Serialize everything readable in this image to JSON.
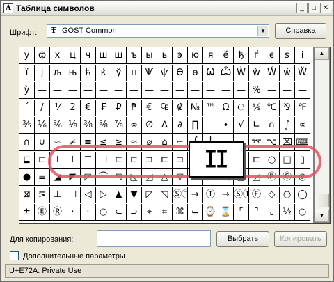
{
  "window": {
    "title": "Таблица символов",
    "app_icon": "charmap-icon",
    "minimize_glyph": "_",
    "maximize_glyph": "□",
    "close_glyph": "✕"
  },
  "font": {
    "label": "Шрифт:",
    "value": "GOST Common",
    "type_glyph": "Ŧ",
    "help_button": "Справка"
  },
  "grid": {
    "rows": [
      [
        "у",
        "ф",
        "х",
        "ц",
        "ч",
        "ш",
        "щ",
        "ъ",
        "ы",
        "ь",
        "э",
        "ю",
        "я",
        "ё",
        "ђ",
        "ѓ",
        "є",
        "ѕ",
        "і"
      ],
      [
        "ї",
        "ј",
        "љ",
        "њ",
        "ћ",
        "ќ",
        "ў",
        "џ",
        "Ѱ",
        "ѱ",
        "Ѳ",
        "ѳ",
        "Ѡ",
        "Ѽ",
        "Ẁ",
        "ẁ",
        "Ẃ",
        "ẃ",
        "Ẅ"
      ],
      [
        "ỳ",
        "—",
        "—",
        "—",
        "—",
        "—",
        "—",
        "—",
        "—",
        "—",
        "—",
        "—",
        "—",
        "—",
        "—",
        "%",
        "—",
        "—",
        "—"
      ],
      [
        "´",
        "/",
        "⅟",
        "2",
        "€",
        "₣",
        "₽",
        "₱",
        "€",
        "₠",
        "₡",
        "№",
        "™",
        "Ω",
        "℮",
        "⅍",
        "℃",
        "⅋",
        "℉"
      ],
      [
        "⅗",
        "⅙",
        "⅚",
        "⅛",
        "⅜",
        "⅝",
        "⅞",
        "∞",
        "∅",
        "∆",
        "∂",
        "∏",
        "—",
        "∙",
        "√",
        "∟",
        "∩",
        "∫",
        "∝"
      ],
      [
        "∩",
        "∪",
        "≈",
        "≠",
        "≡",
        "≤",
        "≥",
        "≈",
        "⌀",
        "⌂",
        "⌐",
        "⌠",
        "⌡",
        "⌢",
        "⌣",
        "⌤",
        "⌥",
        "⌧",
        "⌨"
      ],
      [
        "⊑",
        "⊏",
        "⊥",
        "⊥",
        "⊤",
        "⊣",
        "⊏",
        "⊏",
        "⊐",
        "⊏",
        "⊐",
        "⊏",
        "⊐",
        "⊐",
        "⊐",
        "⊏",
        "○",
        "□",
        "▯"
      ],
      [
        "●",
        "≡",
        "◢",
        "◤",
        "◸",
        "⌒",
        "◹",
        "◺",
        "◿",
        "△",
        "▽",
        "⊿",
        "◸",
        "◹",
        "◺",
        "◿",
        "Ⓟ",
        "Ⓒ",
        "◎"
      ],
      [
        "⊠",
        "⋝",
        "⊥",
        "⊣",
        "◁",
        "▷",
        "▲",
        "▼",
        "◸",
        "◹",
        "ⓈⓉ",
        "→",
        "Ⓣ",
        "→",
        "ⓈⓉ",
        "Ⓕ",
        "◇",
        "○",
        "◯"
      ],
      [
        "±",
        "Ⓔ",
        "Ⓡ",
        "·",
        "·",
        "○",
        "⊂",
        "⊃",
        "⌖",
        "⌗",
        "⌘",
        "⌙",
        "⌚",
        "⌛",
        "⌜",
        "⌝",
        "⌞",
        "½",
        "○"
      ]
    ],
    "zoom_glyph": "ⵊⵊ"
  },
  "copy": {
    "label": "Для копирования:",
    "value": "",
    "select_button": "Выбрать",
    "copy_button": "Копировать"
  },
  "advanced": {
    "label": "Дополнительные параметры",
    "checked": false
  },
  "status": {
    "text": "U+E72A: Private Use"
  },
  "scrollbar": {
    "up_glyph": "▲",
    "down_glyph": "▼",
    "position": 0.9
  },
  "colors": {
    "highlight": "#e85060",
    "window_bg": "#ece9d8",
    "disabled_text": "#a5a596"
  }
}
